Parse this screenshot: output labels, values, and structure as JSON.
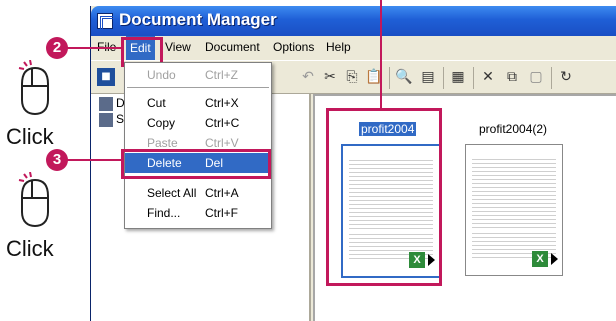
{
  "window": {
    "title": "Document Manager"
  },
  "menubar": {
    "items": [
      "File",
      "Edit",
      "View",
      "Document",
      "Options",
      "Help"
    ]
  },
  "edit_menu": {
    "items": [
      {
        "label": "Undo",
        "shortcut": "Ctrl+Z",
        "enabled": false
      },
      {
        "label": "Cut",
        "shortcut": "Ctrl+X",
        "enabled": true
      },
      {
        "label": "Copy",
        "shortcut": "Ctrl+C",
        "enabled": true
      },
      {
        "label": "Paste",
        "shortcut": "Ctrl+V",
        "enabled": false
      },
      {
        "label": "Delete",
        "shortcut": "Del",
        "enabled": true,
        "highlighted": true
      },
      {
        "label": "Select All",
        "shortcut": "Ctrl+A",
        "enabled": true
      },
      {
        "label": "Find...",
        "shortcut": "Ctrl+F",
        "enabled": true
      }
    ]
  },
  "tree": {
    "items": [
      "D",
      "S"
    ]
  },
  "documents": [
    {
      "name": "profit2004",
      "selected": true
    },
    {
      "name": "profit2004(2)",
      "selected": false
    }
  ],
  "annotations": {
    "step2": "2",
    "step3": "3",
    "click1": "Click",
    "click2": "Click"
  },
  "colors": {
    "accent": "#c2185b",
    "selection": "#316ac5",
    "titlebar": "#1f5fd6"
  }
}
